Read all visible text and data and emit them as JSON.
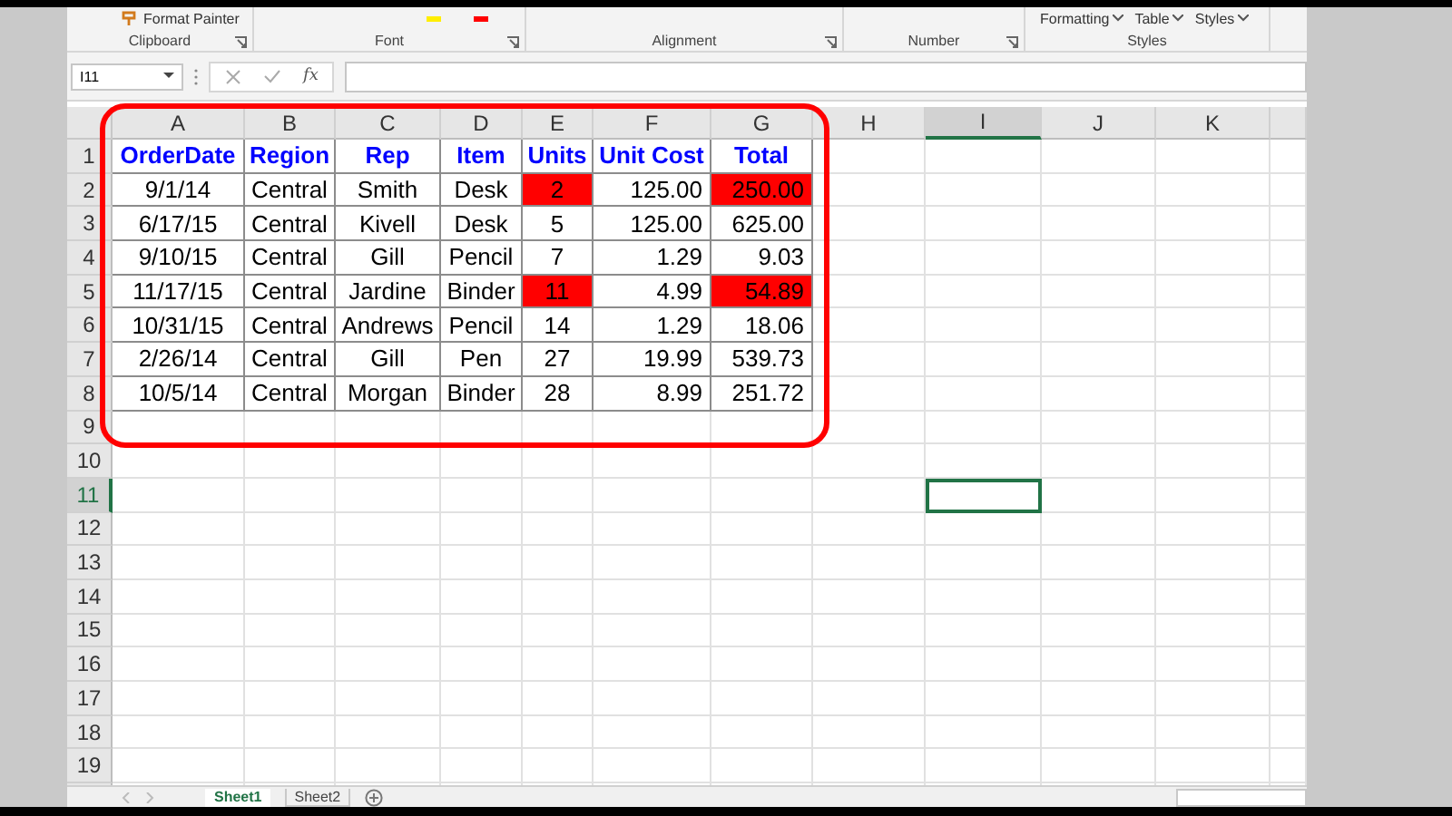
{
  "ribbon": {
    "groups": [
      {
        "label": "Clipboard",
        "launcher": true,
        "items": [
          {
            "kind": "brush",
            "label": "Format Painter"
          }
        ]
      },
      {
        "label": "Font",
        "launcher": true,
        "items": [
          {
            "kind": "swatch",
            "color": "#ffee00"
          },
          {
            "kind": "swatch",
            "color": "#ff0000"
          }
        ]
      },
      {
        "label": "Alignment",
        "launcher": true
      },
      {
        "label": "Number",
        "launcher": true
      },
      {
        "label": "Styles",
        "launcher": false,
        "items": [
          {
            "kind": "dropdown",
            "label": "Formatting"
          },
          {
            "kind": "dropdown",
            "label": "Table"
          },
          {
            "kind": "dropdown",
            "label": "Styles"
          }
        ]
      }
    ]
  },
  "formula_bar": {
    "name_box": "I11",
    "function_label": "fx"
  },
  "sheet": {
    "columns": [
      {
        "label": "A",
        "selected": false
      },
      {
        "label": "B",
        "selected": false
      },
      {
        "label": "C",
        "selected": false
      },
      {
        "label": "D",
        "selected": false
      },
      {
        "label": "E",
        "selected": false
      },
      {
        "label": "F",
        "selected": false
      },
      {
        "label": "G",
        "selected": false
      },
      {
        "label": "H",
        "selected": false
      },
      {
        "label": "I",
        "selected": true
      },
      {
        "label": "J",
        "selected": false
      },
      {
        "label": "K",
        "selected": false
      }
    ],
    "rows": [
      {
        "label": "1",
        "selected": false
      },
      {
        "label": "2",
        "selected": false
      },
      {
        "label": "3",
        "selected": false
      },
      {
        "label": "4",
        "selected": false
      },
      {
        "label": "5",
        "selected": false
      },
      {
        "label": "6",
        "selected": false
      },
      {
        "label": "7",
        "selected": false
      },
      {
        "label": "8",
        "selected": false
      },
      {
        "label": "9",
        "selected": false
      },
      {
        "label": "10",
        "selected": false
      },
      {
        "label": "11",
        "selected": true
      },
      {
        "label": "12",
        "selected": false
      },
      {
        "label": "13",
        "selected": false
      },
      {
        "label": "14",
        "selected": false
      },
      {
        "label": "15",
        "selected": false
      },
      {
        "label": "16",
        "selected": false
      },
      {
        "label": "17",
        "selected": false
      },
      {
        "label": "18",
        "selected": false
      },
      {
        "label": "19",
        "selected": false
      }
    ]
  },
  "table": {
    "header": [
      "OrderDate",
      "Region",
      "Rep",
      "Item",
      "Units",
      "Unit Cost",
      "Total"
    ],
    "rows": [
      [
        {
          "text": "9/1/14",
          "highlight": false
        },
        {
          "text": "Central",
          "highlight": false
        },
        {
          "text": "Smith",
          "highlight": false
        },
        {
          "text": "Desk",
          "highlight": false
        },
        {
          "text": "2",
          "highlight": true
        },
        {
          "text": "125.00",
          "highlight": false
        },
        {
          "text": "250.00",
          "highlight": true
        }
      ],
      [
        {
          "text": "6/17/15",
          "highlight": false
        },
        {
          "text": "Central",
          "highlight": false
        },
        {
          "text": "Kivell",
          "highlight": false
        },
        {
          "text": "Desk",
          "highlight": false
        },
        {
          "text": "5",
          "highlight": false
        },
        {
          "text": "125.00",
          "highlight": false
        },
        {
          "text": "625.00",
          "highlight": false
        }
      ],
      [
        {
          "text": "9/10/15",
          "highlight": false
        },
        {
          "text": "Central",
          "highlight": false
        },
        {
          "text": "Gill",
          "highlight": false
        },
        {
          "text": "Pencil",
          "highlight": false
        },
        {
          "text": "7",
          "highlight": false
        },
        {
          "text": "1.29",
          "highlight": false
        },
        {
          "text": "9.03",
          "highlight": false
        }
      ],
      [
        {
          "text": "11/17/15",
          "highlight": false
        },
        {
          "text": "Central",
          "highlight": false
        },
        {
          "text": "Jardine",
          "highlight": false
        },
        {
          "text": "Binder",
          "highlight": false
        },
        {
          "text": "11",
          "highlight": true
        },
        {
          "text": "4.99",
          "highlight": false
        },
        {
          "text": "54.89",
          "highlight": true
        }
      ],
      [
        {
          "text": "10/31/15",
          "highlight": false
        },
        {
          "text": "Central",
          "highlight": false
        },
        {
          "text": "Andrews",
          "highlight": false
        },
        {
          "text": "Pencil",
          "highlight": false
        },
        {
          "text": "14",
          "highlight": false
        },
        {
          "text": "1.29",
          "highlight": false
        },
        {
          "text": "18.06",
          "highlight": false
        }
      ],
      [
        {
          "text": "2/26/14",
          "highlight": false
        },
        {
          "text": "Central",
          "highlight": false
        },
        {
          "text": "Gill",
          "highlight": false
        },
        {
          "text": "Pen",
          "highlight": false
        },
        {
          "text": "27",
          "highlight": false
        },
        {
          "text": "19.99",
          "highlight": false
        },
        {
          "text": "539.73",
          "highlight": false
        }
      ],
      [
        {
          "text": "10/5/14",
          "highlight": false
        },
        {
          "text": "Central",
          "highlight": false
        },
        {
          "text": "Morgan",
          "highlight": false
        },
        {
          "text": "Binder",
          "highlight": false
        },
        {
          "text": "28",
          "highlight": false
        },
        {
          "text": "8.99",
          "highlight": false
        },
        {
          "text": "251.72",
          "highlight": false
        }
      ]
    ]
  },
  "sheet_tabs": [
    {
      "label": "Sheet1",
      "selected": true
    },
    {
      "label": "Sheet2",
      "selected": false
    }
  ]
}
